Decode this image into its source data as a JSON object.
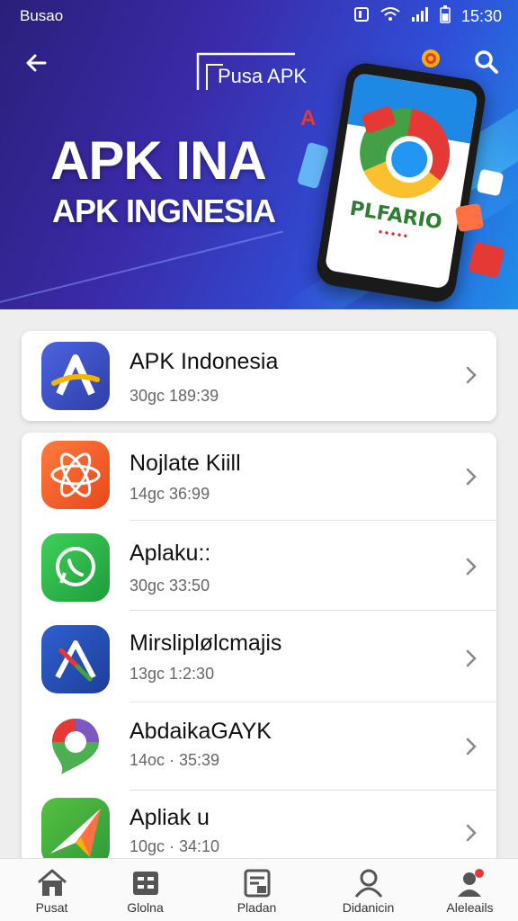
{
  "status_bar": {
    "left_text": "Busao",
    "time": "15:30"
  },
  "header": {
    "brand": "Pusa APK",
    "hero_title": "APK INA",
    "hero_subtitle": "APK INGNESIA",
    "phone_label": "PLFARIO"
  },
  "featured": {
    "name": "APK Indonesia",
    "meta": "30gc 189:39",
    "icon": "apk-a-icon",
    "color": "#3f51c5"
  },
  "apps": [
    {
      "name": "Nojlate Kiill",
      "meta": "14gc 36:99",
      "icon": "atom-a-icon",
      "color": "#f06a2a"
    },
    {
      "name": "Aplaku::",
      "meta": "30gc 33:50",
      "icon": "whatsapp-icon",
      "color": "#2fb54a"
    },
    {
      "name": "Mirsliplølcmajis",
      "meta": "13gc 1:2:30",
      "icon": "app-store-icon",
      "color": "#2a4fb0"
    },
    {
      "name": "AbdaikaGAYK",
      "meta": "14oc · 35:39",
      "icon": "map-pin-icon",
      "color": "#ffffff"
    },
    {
      "name": "Apliak u",
      "meta": "10gc · 34:10",
      "icon": "paper-plane-icon",
      "color": "#4caf50"
    }
  ],
  "bottom_nav": [
    {
      "label": "Pusat",
      "icon": "home-icon"
    },
    {
      "label": "Glolna",
      "icon": "apps-grid-icon"
    },
    {
      "label": "Pladan",
      "icon": "document-icon"
    },
    {
      "label": "Didanicin",
      "icon": "profile-icon"
    },
    {
      "label": "Aleleails",
      "icon": "account-icon"
    }
  ]
}
